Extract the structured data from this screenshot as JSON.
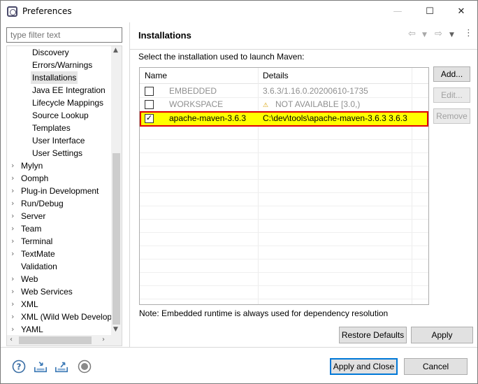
{
  "window": {
    "title": "Preferences",
    "controls": {
      "minimize": "—",
      "maximize": "☐",
      "close": "✕"
    }
  },
  "filter": {
    "placeholder": "type filter text"
  },
  "tree": {
    "children": [
      {
        "label": "Discovery"
      },
      {
        "label": "Errors/Warnings"
      },
      {
        "label": "Installations",
        "selected": true
      },
      {
        "label": "Java EE Integration"
      },
      {
        "label": "Lifecycle Mappings"
      },
      {
        "label": "Source Lookup"
      },
      {
        "label": "Templates"
      },
      {
        "label": "User Interface"
      },
      {
        "label": "User Settings"
      }
    ],
    "top_level": [
      {
        "label": "Mylyn",
        "expandable": true
      },
      {
        "label": "Oomph",
        "expandable": true
      },
      {
        "label": "Plug-in Development",
        "expandable": true
      },
      {
        "label": "Run/Debug",
        "expandable": true
      },
      {
        "label": "Server",
        "expandable": true
      },
      {
        "label": "Team",
        "expandable": true
      },
      {
        "label": "Terminal",
        "expandable": true
      },
      {
        "label": "TextMate",
        "expandable": true
      },
      {
        "label": "Validation",
        "expandable": false
      },
      {
        "label": "Web",
        "expandable": true
      },
      {
        "label": "Web Services",
        "expandable": true
      },
      {
        "label": "XML",
        "expandable": true
      },
      {
        "label": "XML (Wild Web Develop",
        "expandable": true
      },
      {
        "label": "YAML",
        "expandable": true
      }
    ]
  },
  "page": {
    "title": "Installations",
    "description": "Select the installation used to launch Maven:",
    "note": "Note: Embedded runtime is always used for dependency resolution"
  },
  "table": {
    "columns": [
      "Name",
      "Details"
    ],
    "rows": [
      {
        "checked": false,
        "name": "EMBEDDED",
        "details": "3.6.3/1.16.0.20200610-1735",
        "dimmed": true
      },
      {
        "checked": false,
        "name": "WORKSPACE",
        "details": "NOT AVAILABLE [3.0,)",
        "dimmed": true,
        "warning": true
      },
      {
        "checked": true,
        "name": "apache-maven-3.6.3",
        "details": "C:\\dev\\tools\\apache-maven-3.6.3 3.6.3",
        "highlighted": true
      }
    ]
  },
  "side_buttons": {
    "add": "Add...",
    "edit": "Edit...",
    "remove": "Remove"
  },
  "buttons": {
    "restore_defaults": "Restore Defaults",
    "apply": "Apply",
    "apply_and_close": "Apply and Close",
    "cancel": "Cancel"
  },
  "bottom_icons": [
    "help-icon",
    "import-icon",
    "export-icon",
    "record-icon"
  ],
  "colors": {
    "highlight_fill": "#ffff00",
    "highlight_border": "#e00000",
    "default_button_border": "#0078d7"
  }
}
